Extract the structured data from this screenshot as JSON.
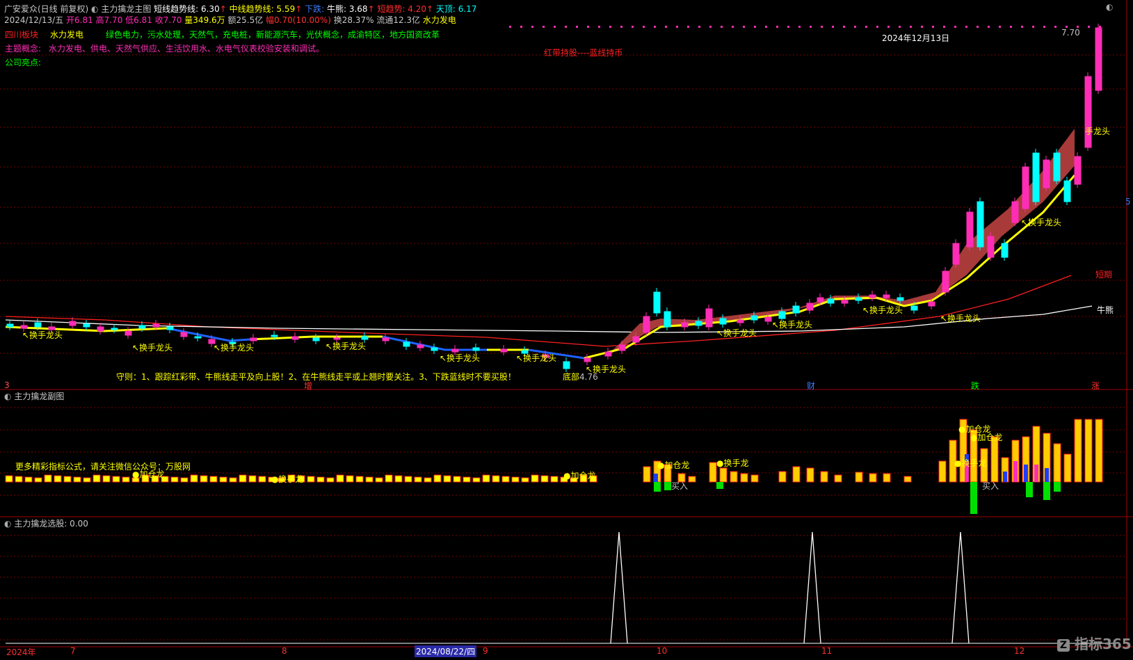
{
  "header": {
    "stock_title": "广安爱众(日线 前复权)",
    "main_indicator": "主力擒龙主图",
    "short_trend": "短线趋势线: 6.30",
    "mid_trend": "中线趋势线: 5.59",
    "down": "下跌:",
    "bull": "牛熊: 3.68",
    "short_term": "短趋势: 4.20",
    "top": "天顶: 6.17",
    "date_line": "2024/12/13/五",
    "open": "开6.81",
    "high": "高7.70",
    "low": "低6.81",
    "close": "收7.70",
    "volume": "量349.6万",
    "amount": "额25.5亿",
    "change": "幅0.70(10.00%)",
    "turnover": "换28.37%",
    "float": "流通12.3亿",
    "industry": "水力发电"
  },
  "info": {
    "region_label": "四川板块",
    "region_value": "水力发电",
    "concepts_inline": "绿色电力，污水处理，天然气，充电桩，新能源汽车，光伏概念，成渝特区，地方国资改革",
    "theme_label": "主题概念:",
    "theme_value": "水力发电、供电、天然气供应、生活饮用水、水电气仪表校验安装和调试。",
    "company_label": "公司亮点:",
    "date_label": "2024年12月13日",
    "hold_tip": "红带持股----蓝线持币",
    "rule_text": "守则：1、跟踪红彩带、牛熊线走平及向上股！2、在牛熊线走平或上翘时要关注。3、下跌蓝线时不要买股！",
    "price_high_label": "7.70",
    "low_price_label": "4.76",
    "low_prefix": "底部",
    "short_label": "短期",
    "bull_label": "牛熊",
    "dragon_label": "换手龙头",
    "dragon_last": "手龙头",
    "marks": [
      "增",
      "财",
      "跌",
      "涨"
    ],
    "left_mark": "3",
    "right_edge_mark": "5"
  },
  "sub1": {
    "title": "主力擒龙副图",
    "promo": "更多精彩指标公式，请关注微信公众号：万股网",
    "add_label": "加仓龙",
    "swap_label": "换手龙",
    "buy_label": "买入"
  },
  "sub2": {
    "title": "主力擒龙选股",
    "value": ": 0.00"
  },
  "xaxis": {
    "labels": [
      "2024年",
      "7",
      "8",
      "2024/08/22/四",
      "9",
      "10",
      "11",
      "12"
    ]
  },
  "watermark": "指标365",
  "chart_data": {
    "type": "candlestick",
    "title": "主力擒龙主图",
    "last_close": 7.7,
    "last_high": 7.7,
    "last_low": 6.81,
    "last_open": 6.81,
    "period_low": 4.76,
    "indicators": {
      "short_trend": 6.3,
      "mid_trend": 5.59,
      "bull_bear": 3.68,
      "short_term": 4.2,
      "top": 6.17
    },
    "signal_peaks_x": [
      "2024-09-27",
      "2024-11-07",
      "2024-11-28"
    ],
    "signal_value": 0.0
  },
  "colors": {
    "up": "#ff2db6",
    "down": "#00ffff",
    "yellow": "#ffff00",
    "blue": "#1e63ff",
    "red": "#ff2020",
    "white": "#ffffff",
    "ribbon": "#a83a3a"
  }
}
